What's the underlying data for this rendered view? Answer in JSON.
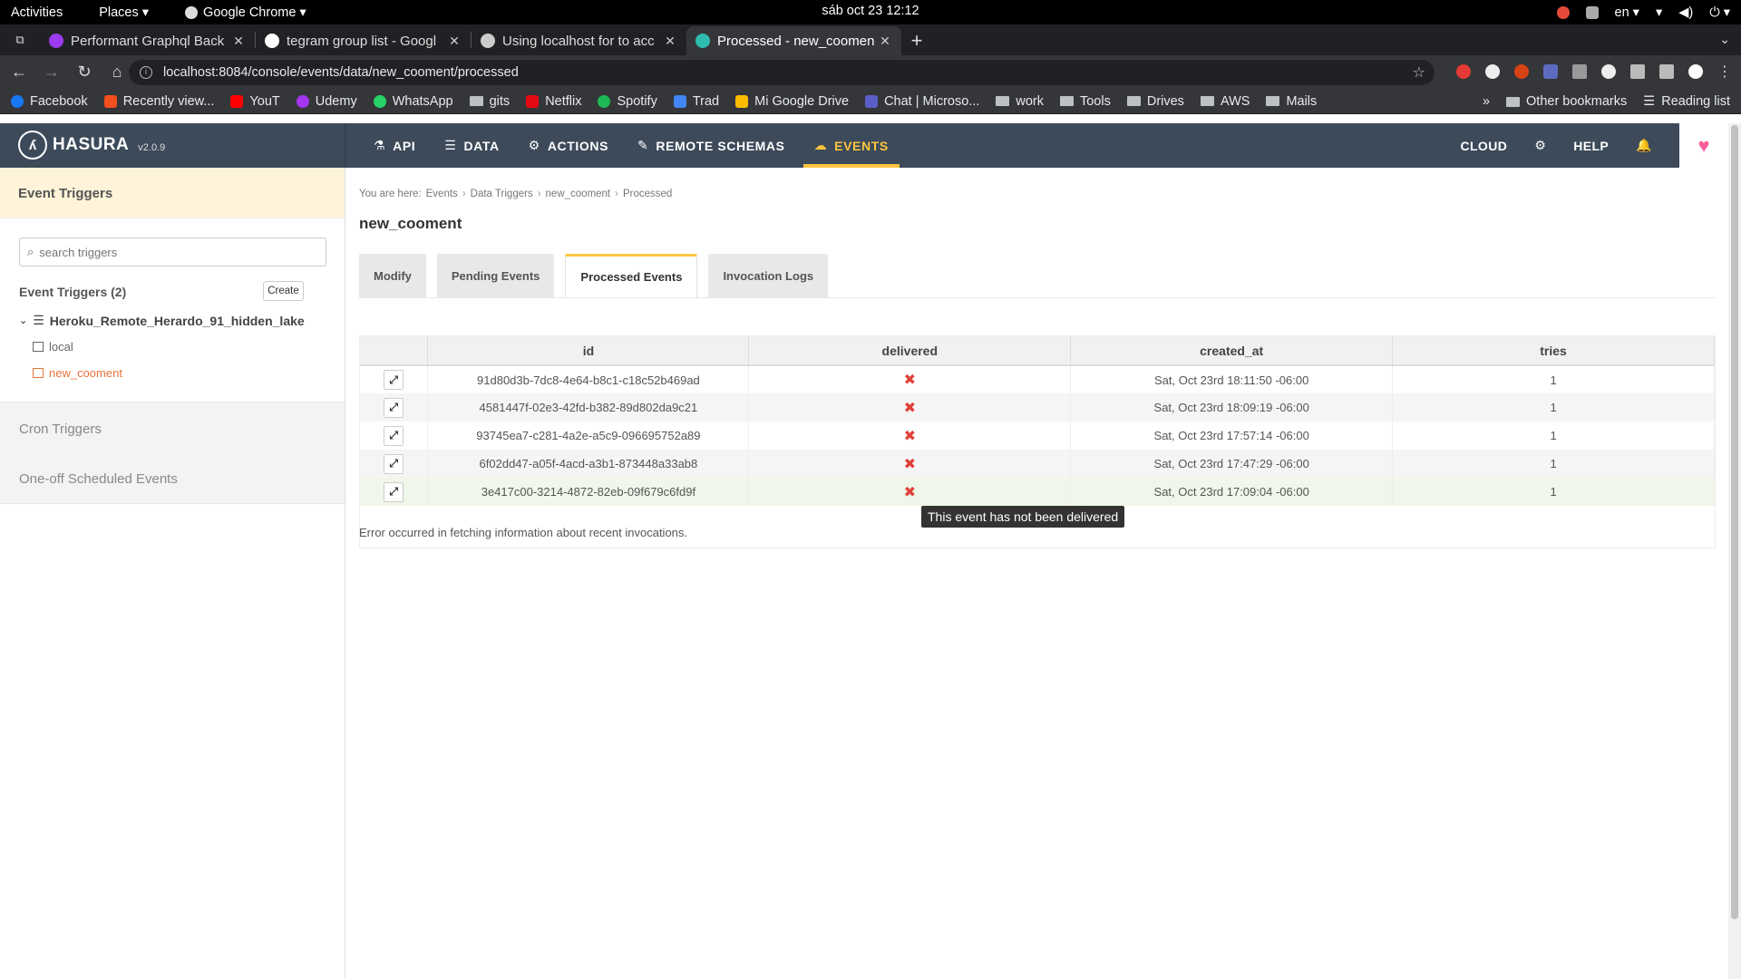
{
  "os": {
    "activities": "Activities",
    "places": "Places ▾",
    "app_menu": "Google Chrome ▾",
    "clock": "sáb oct 23  12:12",
    "lang": "en ▾"
  },
  "browser": {
    "tabs": [
      {
        "title": "Performant Graphql Back",
        "active": false
      },
      {
        "title": "tegram group list - Googl",
        "active": false
      },
      {
        "title": "Using localhost for to acc",
        "active": false
      },
      {
        "title": "Processed - new_coomen",
        "active": true
      }
    ],
    "url": "localhost:8084/console/events/data/new_cooment/processed",
    "bookmarks": [
      "Facebook",
      "Recently view...",
      "YouT",
      "Udemy",
      "WhatsApp",
      "gits",
      "Netflix",
      "Spotify",
      "Trad",
      "Mi Google Drive",
      "Chat | Microso...",
      "work",
      "Tools",
      "Drives",
      "AWS",
      "Mails"
    ],
    "other_bookmarks": "Other bookmarks",
    "reading_list": "Reading list",
    "more_bookmarks": "»"
  },
  "hasura": {
    "logo_text": "HASURA",
    "version": "v2.0.9",
    "nav": [
      {
        "label": "API",
        "icon": "flask-icon"
      },
      {
        "label": "DATA",
        "icon": "database-icon"
      },
      {
        "label": "ACTIONS",
        "icon": "cogs-icon"
      },
      {
        "label": "REMOTE SCHEMAS",
        "icon": "plug-icon"
      },
      {
        "label": "EVENTS",
        "icon": "cloud-icon",
        "active": true
      }
    ],
    "right": {
      "cloud": "CLOUD",
      "help": "HELP"
    },
    "accent_color": "#fec53d",
    "header_color": "#3c4a5a"
  },
  "sidebar": {
    "section_title": "Event Triggers",
    "search_placeholder": "search triggers",
    "triggers_title": "Event Triggers (2)",
    "create_label": "Create",
    "database": "Heroku_Remote_Herardo_91_hidden_lake",
    "tables": [
      {
        "name": "local",
        "active": false
      },
      {
        "name": "new_cooment",
        "active": true
      }
    ],
    "cron": "Cron Triggers",
    "oneoff": "One-off Scheduled Events"
  },
  "main": {
    "breadcrumb": {
      "prefix": "You are here:",
      "items": [
        "Events",
        "Data Triggers",
        "new_cooment",
        "Processed"
      ]
    },
    "title": "new_cooment",
    "tabs": [
      {
        "label": "Modify",
        "active": false
      },
      {
        "label": "Pending Events",
        "active": false
      },
      {
        "label": "Processed Events",
        "active": true
      },
      {
        "label": "Invocation Logs",
        "active": false
      }
    ],
    "table": {
      "columns": [
        "",
        "id",
        "delivered",
        "created_at",
        "tries"
      ],
      "rows": [
        {
          "id": "91d80d3b-7dc8-4e64-b8c1-c18c52b469ad",
          "delivered": "✖",
          "created_at": "Sat, Oct 23rd 18:11:50 -06:00",
          "tries": "1"
        },
        {
          "id": "4581447f-02e3-42fd-b382-89d802da9c21",
          "delivered": "✖",
          "created_at": "Sat, Oct 23rd 18:09:19 -06:00",
          "tries": "1"
        },
        {
          "id": "93745ea7-c281-4a2e-a5c9-096695752a89",
          "delivered": "✖",
          "created_at": "Sat, Oct 23rd 17:57:14 -06:00",
          "tries": "1"
        },
        {
          "id": "6f02dd47-a05f-4acd-a3b1-873448a33ab8",
          "delivered": "✖",
          "created_at": "Sat, Oct 23rd 17:47:29 -06:00",
          "tries": "1"
        },
        {
          "id": "3e417c00-3214-4872-82eb-09f679c6fd9f",
          "delivered": "✖",
          "created_at": "Sat, Oct 23rd 17:09:04 -06:00",
          "tries": "1"
        }
      ]
    },
    "tooltip": "This event has not been delivered",
    "error": "Error occurred in fetching information about recent invocations."
  }
}
